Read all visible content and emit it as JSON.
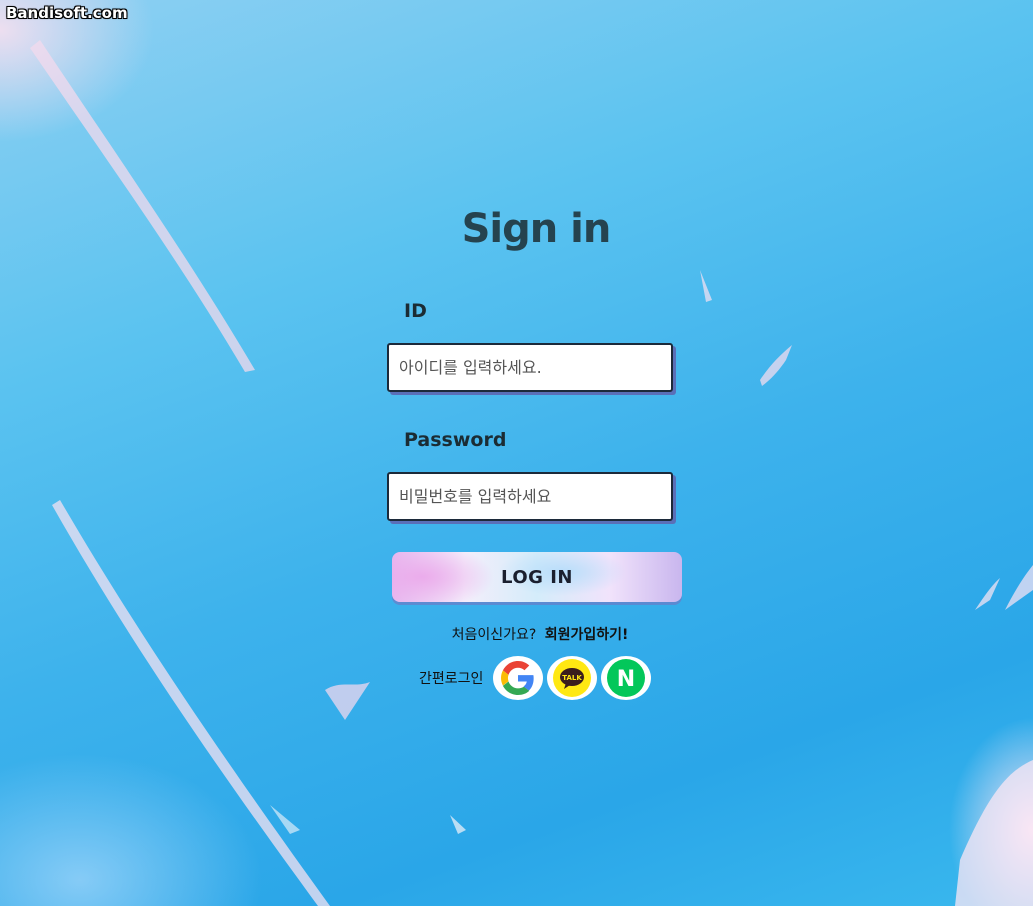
{
  "watermark": "Bandisoft.com",
  "signin": {
    "title": "Sign in",
    "id_label": "ID",
    "id_placeholder": "아이디를 입력하세요.",
    "password_label": "Password",
    "password_placeholder": "비밀번호를 입력하세요",
    "login_label": "LOG IN",
    "first_time_text": "처음이신가요?",
    "signup_link": "회원가입하기!",
    "easy_login_label": "간편로그인",
    "social": [
      {
        "name": "Google",
        "icon": "google-icon"
      },
      {
        "name": "KakaoTalk",
        "icon": "kakaotalk-icon",
        "text": "TALK"
      },
      {
        "name": "Naver",
        "icon": "naver-icon",
        "text": "N"
      }
    ]
  },
  "colors": {
    "title": "#25434f",
    "input_shadow": "#5a6fb8",
    "kakao": "#ffe812",
    "naver": "#03c75a"
  }
}
